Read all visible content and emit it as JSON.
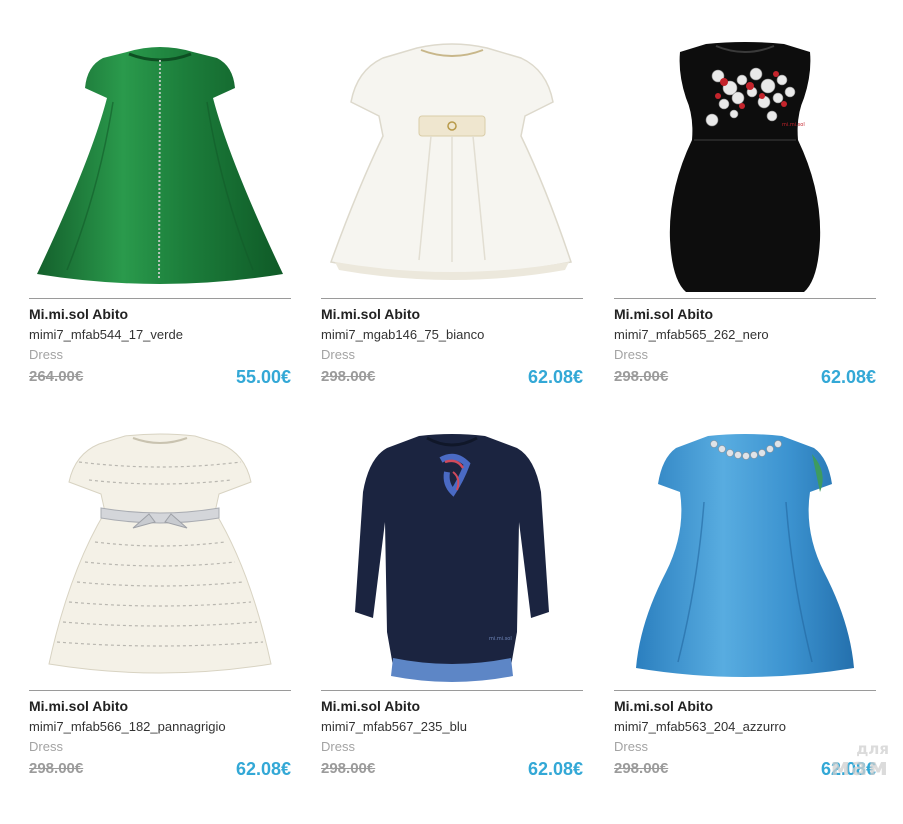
{
  "products": [
    {
      "brand": "Mi.mi.sol Abito",
      "sku": "mimi7_mfab544_17_verde",
      "category": "Dress",
      "old_price": "264.00€",
      "new_price": "55.00€",
      "image": "green-dress",
      "color": "#1f7a3c"
    },
    {
      "brand": "Mi.mi.sol Abito",
      "sku": "mimi7_mgab146_75_bianco",
      "category": "Dress",
      "old_price": "298.00€",
      "new_price": "62.08€",
      "image": "white-dress",
      "color": "#f4f2ec"
    },
    {
      "brand": "Mi.mi.sol Abito",
      "sku": "mimi7_mfab565_262_nero",
      "category": "Dress",
      "old_price": "298.00€",
      "new_price": "62.08€",
      "image": "black-sequin-dress",
      "color": "#111111"
    },
    {
      "brand": "Mi.mi.sol Abito",
      "sku": "mimi7_mfab566_182_pannagrigio",
      "category": "Dress",
      "old_price": "298.00€",
      "new_price": "62.08€",
      "image": "cream-ruffle-dress",
      "color": "#f2efe6"
    },
    {
      "brand": "Mi.mi.sol Abito",
      "sku": "mimi7_mfab567_235_blu",
      "category": "Dress",
      "old_price": "298.00€",
      "new_price": "62.08€",
      "image": "navy-knit-dress",
      "color": "#1c2742"
    },
    {
      "brand": "Mi.mi.sol Abito",
      "sku": "mimi7_mfab563_204_azzurro",
      "category": "Dress",
      "old_price": "298.00€",
      "new_price": "62.08€",
      "image": "light-blue-dress",
      "color": "#3f95cf"
    }
  ],
  "watermark": {
    "line1": "для",
    "line2": "мам"
  },
  "colors": {
    "price_accent": "#33a8d6",
    "old_price": "#9b9b9b",
    "divider": "#9a9a9a"
  }
}
